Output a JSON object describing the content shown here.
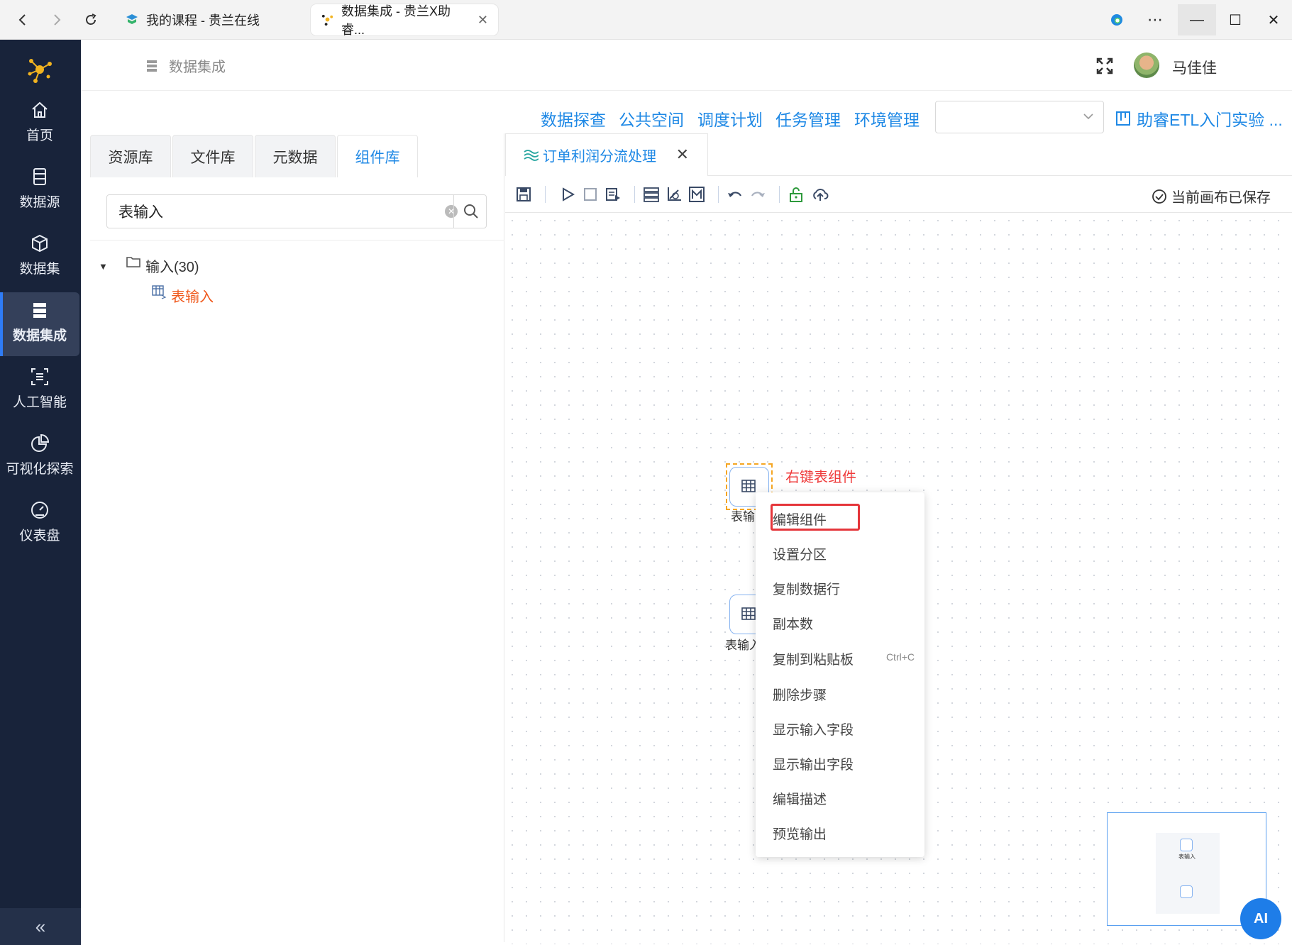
{
  "browser": {
    "tabs": [
      {
        "title": "我的课程 - 贵兰在线",
        "active": false
      },
      {
        "title": "数据集成 - 贵兰X助睿...",
        "active": true
      }
    ]
  },
  "sidebar": {
    "items": [
      {
        "label": "首页",
        "icon": "home-icon"
      },
      {
        "label": "数据源",
        "icon": "database-icon"
      },
      {
        "label": "数据集",
        "icon": "cube-icon"
      },
      {
        "label": "数据集成",
        "icon": "server-icon",
        "active": true
      },
      {
        "label": "人工智能",
        "icon": "ai-icon"
      },
      {
        "label": "可视化探索",
        "icon": "pie-chart-icon"
      },
      {
        "label": "仪表盘",
        "icon": "gauge-icon"
      }
    ],
    "collapse_label": "«"
  },
  "header": {
    "breadcrumb": "数据集成",
    "username": "马佳佳"
  },
  "topnav": {
    "links": [
      "数据探查",
      "公共空间",
      "调度计划",
      "任务管理",
      "环境管理"
    ],
    "select_value": "",
    "project": "助睿ETL入门实验 ..."
  },
  "leftpanel": {
    "tabs": [
      "资源库",
      "文件库",
      "元数据",
      "组件库"
    ],
    "active_tab": "组件库",
    "search_value": "表输入",
    "tree": {
      "folder": "输入(30)",
      "leaf": "表输入"
    }
  },
  "canvas": {
    "tab_title": "订单利润分流处理",
    "saved_status": "当前画布已保存",
    "hint": "右键表组件",
    "nodes": [
      {
        "label": "表输",
        "selected": true
      },
      {
        "label": "表输入",
        "selected": false
      }
    ],
    "context_menu": [
      {
        "label": "编辑组件",
        "shortcut": ""
      },
      {
        "label": "设置分区",
        "shortcut": ""
      },
      {
        "label": "复制数据行",
        "shortcut": ""
      },
      {
        "label": "副本数",
        "shortcut": ""
      },
      {
        "label": "复制到粘贴板",
        "shortcut": "Ctrl+C"
      },
      {
        "label": "删除步骤",
        "shortcut": ""
      },
      {
        "label": "显示输入字段",
        "shortcut": ""
      },
      {
        "label": "显示输出字段",
        "shortcut": ""
      },
      {
        "label": "编辑描述",
        "shortcut": ""
      },
      {
        "label": "预览输出",
        "shortcut": ""
      }
    ],
    "minimap_node_label": "表输入",
    "ai_button": "AI"
  },
  "colors": {
    "accent": "#1e88e5",
    "sidebar_bg": "#18233a",
    "leaf_highlight": "#f05a1e",
    "hint_red": "#ef3b3b"
  }
}
